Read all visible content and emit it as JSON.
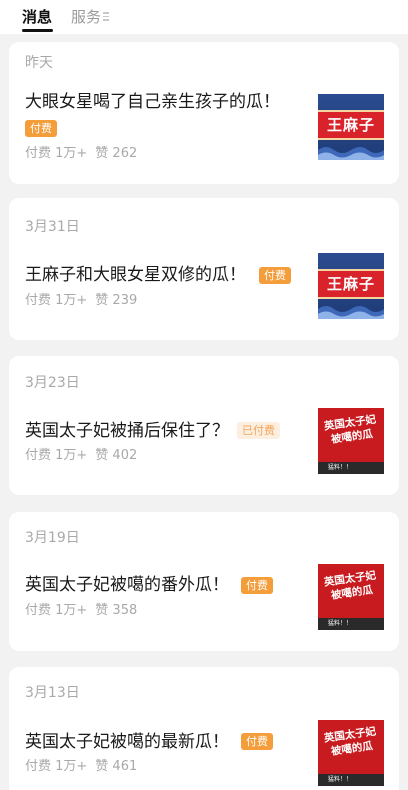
{
  "tabs": {
    "active": "消息",
    "inactive": "服务"
  },
  "icons": {
    "menu": "menu-lines-icon"
  },
  "colors": {
    "badge_paid_bg": "#f39d3b",
    "badge_done_bg": "#fdefe0",
    "badge_done_text": "#f2a55a",
    "thumb_red": "#c81b1f",
    "thumb_blue": "#2b4c8f"
  },
  "feed": [
    {
      "date": "昨天",
      "title": "大眼女星喝了自己亲生孩子的瓜！",
      "badge": "付费",
      "payers": "付费 1万+",
      "likes": "赞 262",
      "thumb_text": "王麻子"
    },
    {
      "date": "3月31日",
      "title": "王麻子和大眼女星双修的瓜！",
      "badge": "付费",
      "payers": "付费 1万+",
      "likes": "赞 239",
      "thumb_text": "王麻子"
    },
    {
      "date": "3月23日",
      "title": "英国太子妃被捅后保住了？",
      "badge": "已付费",
      "payers": "付费 1万+",
      "likes": "赞 402",
      "thumb_text": "英国太子妃被噶的瓜",
      "thumb_strip": "猛料！！"
    },
    {
      "date": "3月19日",
      "title": "英国太子妃被噶的番外瓜！",
      "badge": "付费",
      "payers": "付费 1万+",
      "likes": "赞 358",
      "thumb_text": "英国太子妃被噶的瓜",
      "thumb_strip": "猛料！！"
    },
    {
      "date": "3月13日",
      "title": "英国太子妃被噶的最新瓜！",
      "badge": "付费",
      "payers": "付费 1万+",
      "likes": "赞 461",
      "thumb_text": "英国太子妃被噶的瓜",
      "thumb_strip": "猛料！！"
    }
  ]
}
